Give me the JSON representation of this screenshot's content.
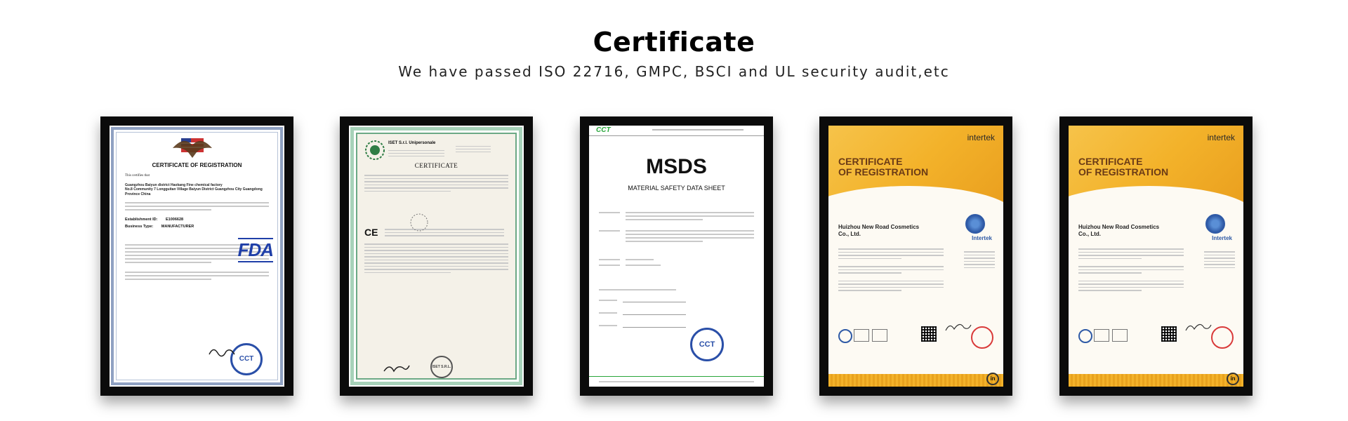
{
  "header": {
    "title": "Certificate",
    "subtitle": "We have passed ISO 22716, GMPC, BSCI and UL security audit,etc"
  },
  "certificates": [
    {
      "title": "CERTIFICATE OF REGISTRATION",
      "certifies": "This certifies that",
      "company": "Guangzhou Baiyun district Haokang Fine chemical factory",
      "address": "No.8 Community 7 Longguitan Village Baiyun District Guangzhou City Guangdong Province China",
      "establishment_label": "Establishment ID:",
      "establishment_value": "E1006628",
      "business_label": "Business Type:",
      "business_value": "MANUFACTURER",
      "logo": "FDA",
      "seal": "CCT"
    },
    {
      "issuer": "ISET S.r.l. Unipersonale",
      "title": "CERTIFICATE",
      "seal": "ISET S.R.L."
    },
    {
      "logo": "CCT",
      "title": "MSDS",
      "subtitle": "MATERIAL SAFETY DATA SHEET",
      "seal": "CCT"
    },
    {
      "brand": "intertek",
      "title_line1": "CERTIFICATE",
      "title_line2": "OF REGISTRATION",
      "company_line1": "Huizhou New Road Cosmetics",
      "company_line2": "Co., Ltd.",
      "globe_label": "Intertek"
    },
    {
      "brand": "intertek",
      "title_line1": "CERTIFICATE",
      "title_line2": "OF REGISTRATION",
      "company_line1": "Huizhou New Road Cosmetics",
      "company_line2": "Co., Ltd.",
      "globe_label": "Intertek"
    }
  ]
}
